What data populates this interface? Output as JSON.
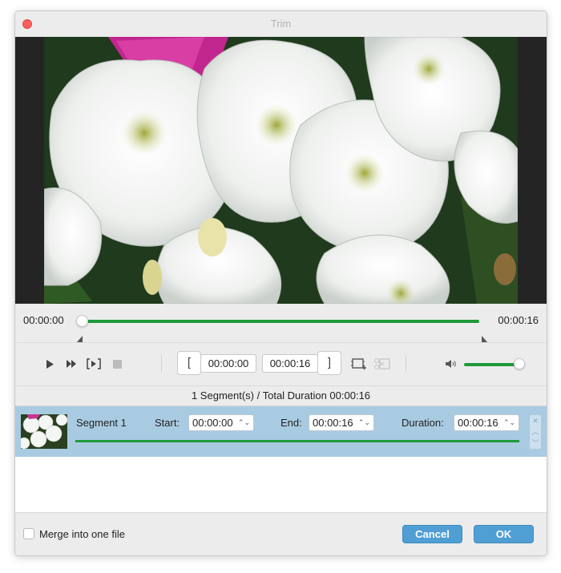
{
  "window": {
    "title": "Trim"
  },
  "timeline": {
    "start_time": "00:00:00",
    "end_time": "00:00:16",
    "position_fraction": 0.0
  },
  "controls": {
    "start_time_value": "00:00:00",
    "end_time_value": "00:00:16",
    "set_start_icon": "[",
    "set_end_icon": "]",
    "volume_level": 1.0
  },
  "summary": {
    "text": "1 Segment(s) / Total Duration 00:00:16"
  },
  "segments": [
    {
      "name": "Segment 1",
      "start_label": "Start:",
      "start_value": "00:00:00",
      "end_label": "End:",
      "end_value": "00:00:16",
      "duration_label": "Duration:",
      "duration_value": "00:00:16"
    }
  ],
  "footer": {
    "merge_label": "Merge into one file",
    "merge_checked": false,
    "cancel_label": "Cancel",
    "ok_label": "OK"
  },
  "colors": {
    "accent_green": "#1f9a3b",
    "button_blue": "#4f9fd4",
    "segment_row_bg": "#a9cbe2",
    "close_red": "#fc605c"
  },
  "icons": [
    "close-icon",
    "play-icon",
    "fast-forward-icon",
    "play-segment-icon",
    "stop-icon",
    "crop-icon",
    "split-icon",
    "volume-icon",
    "remove-segment-icon",
    "move-up-icon",
    "move-down-icon"
  ]
}
